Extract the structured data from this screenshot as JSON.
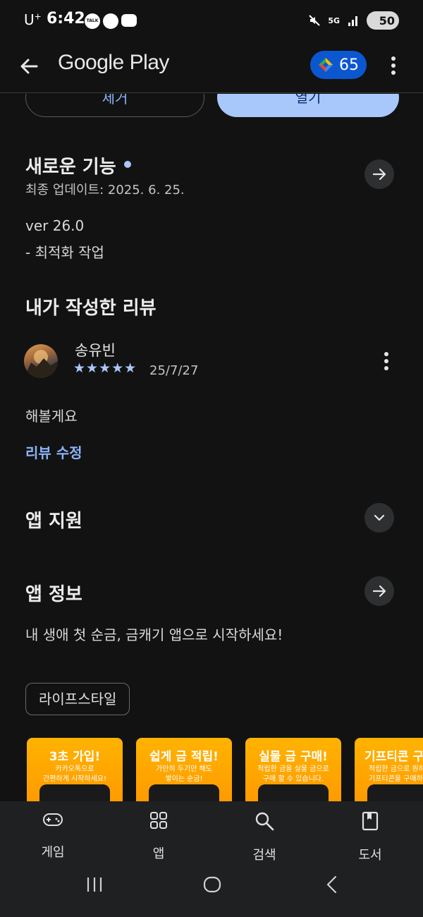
{
  "status_bar": {
    "carrier": "U",
    "carrier_sup": "+",
    "time": "6:42",
    "talk_badge": "TALK",
    "network": "5G",
    "battery": "50"
  },
  "app_bar": {
    "title": "Google Play",
    "points": "65"
  },
  "top_buttons": {
    "remove": "제거",
    "open": "열기"
  },
  "whats_new": {
    "title": "새로운 기능",
    "updated": "최종 업데이트: 2025. 6. 25.",
    "version": "ver 26.0",
    "notes": "- 최적화 작업"
  },
  "my_review": {
    "title": "내가 작성한 리뷰",
    "reviewer": "송유빈",
    "stars": "★★★★★",
    "rating": 5,
    "date": "25/7/27",
    "text": "해볼게요",
    "edit": "리뷰 수정"
  },
  "app_support": {
    "title": "앱 지원"
  },
  "about": {
    "title": "앱 정보",
    "description": "내 생애 첫 순금, 금캐기 앱으로 시작하세요!",
    "category": "라이프스타일"
  },
  "screenshots": [
    {
      "title": "3초 가입!",
      "line1": "카카오톡으로",
      "line2": "간편하게 시작하세요!"
    },
    {
      "title": "쉽게 금 적립!",
      "line1": "가만히 두기만 해도",
      "line2": "쌓이는 순금!"
    },
    {
      "title": "실물 금 구매!",
      "line1": "적립한 금을 실물 금으로",
      "line2": "구매 할 수 있습니다."
    },
    {
      "title": "기프티콘 구",
      "line1": "적립한 금으로 원하",
      "line2": "기프티콘을 구매하"
    }
  ],
  "bottom_nav": {
    "games": "게임",
    "apps": "앱",
    "search": "검색",
    "books": "도서"
  },
  "colors": {
    "background": "#121212",
    "accent": "#a8c7fa",
    "link": "#8ab4f8",
    "points_badge": "#0b57d0",
    "star": "#a8c7fa"
  }
}
